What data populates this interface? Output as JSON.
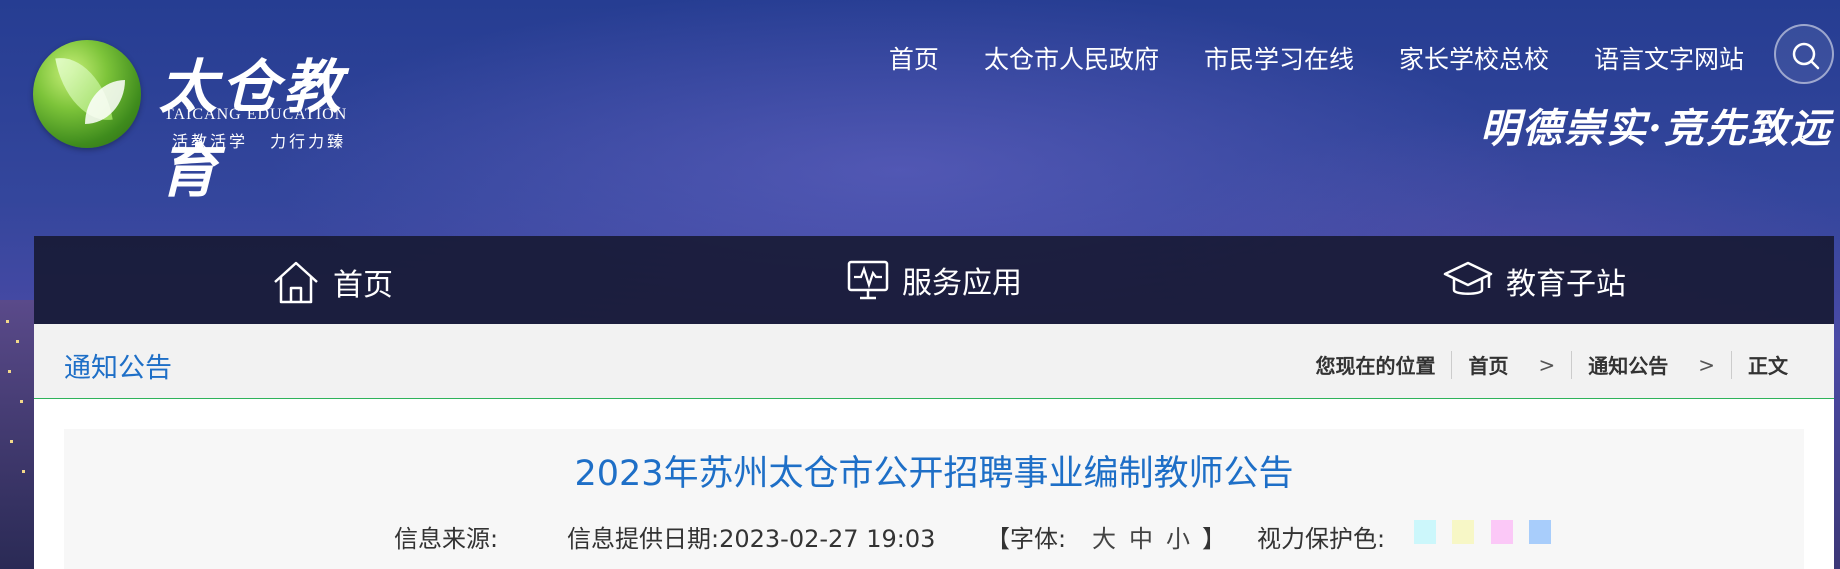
{
  "logo": {
    "title": "太仓教育",
    "english": "TAICANG EDUCATION",
    "slogan": "活教活学 力行力臻"
  },
  "top_links": [
    "首页",
    "太仓市人民政府",
    "市民学习在线",
    "家长学校总校",
    "语言文字网站"
  ],
  "search": {
    "icon": "search-icon"
  },
  "motto": "明德崇实·竞先致远",
  "main_nav": [
    {
      "label": "首页",
      "icon": "home-icon"
    },
    {
      "label": "服务应用",
      "icon": "monitor-icon"
    },
    {
      "label": "教育子站",
      "icon": "graduation-cap-icon"
    }
  ],
  "section": {
    "title": "通知公告"
  },
  "breadcrumb": {
    "prefix": "您现在的位置",
    "items": [
      "首页",
      "通知公告",
      "正文"
    ],
    "separator": ">"
  },
  "article": {
    "title": "2023年苏州太仓市公开招聘事业编制教师公告",
    "source_label": "信息来源:",
    "date_label": "信息提供日期:2023-02-27 19:03",
    "font_open": "【字体:",
    "font_sizes": [
      "大",
      "中",
      "小"
    ],
    "font_close": "】",
    "eye_label": "视力保护色:",
    "eye_colors": [
      "#ccf7fb",
      "#f7f7c6",
      "#fbc8f7",
      "#a8cdfb"
    ]
  },
  "colors": {
    "accent_blue": "#1e6fc7",
    "nav_bg": "#16182f",
    "divider_green": "#2fb35a"
  }
}
